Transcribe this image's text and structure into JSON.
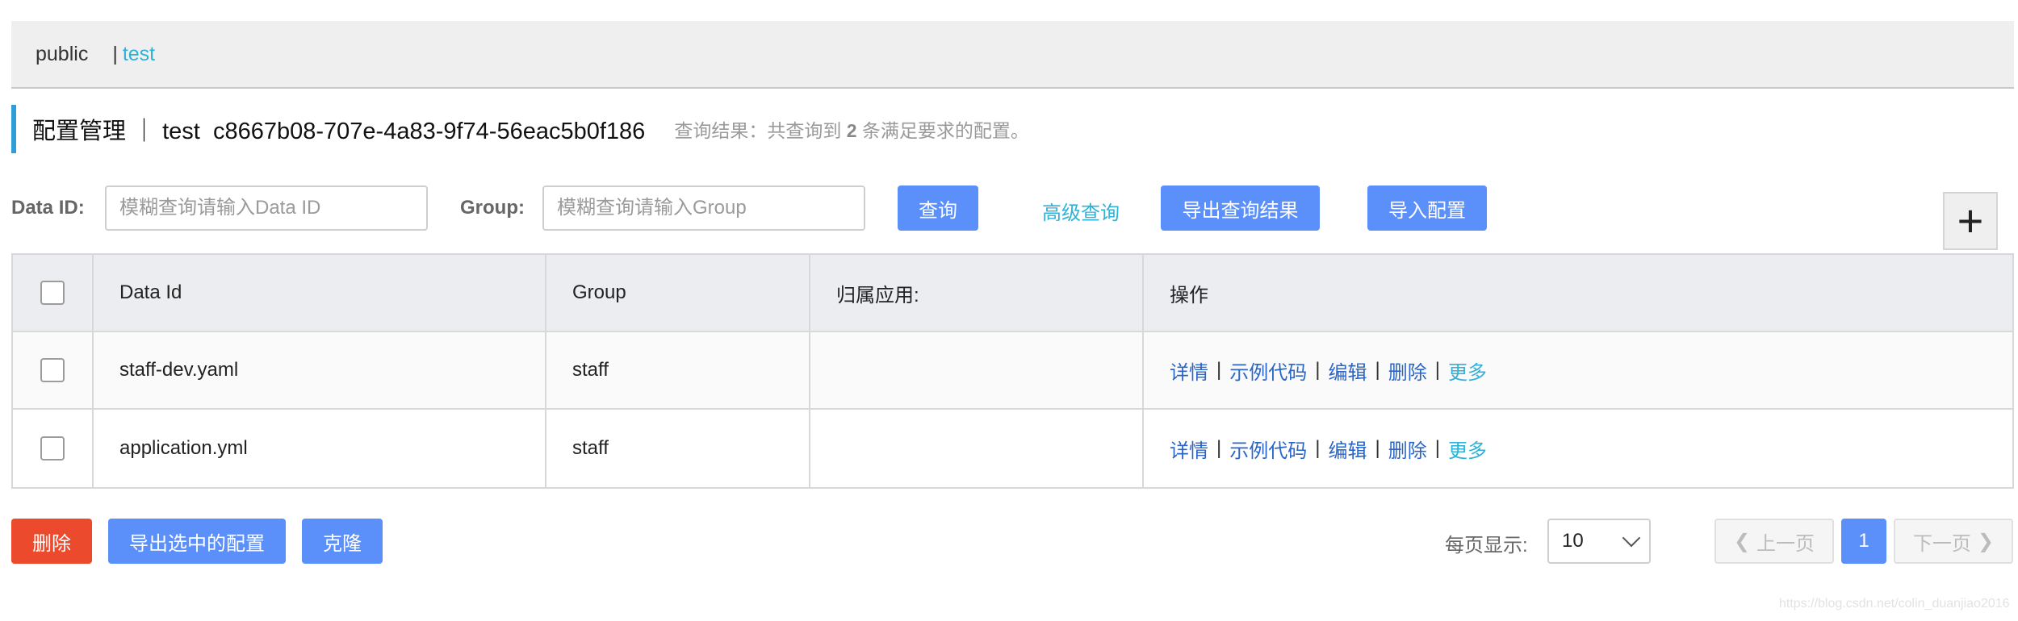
{
  "namespaces": [
    {
      "label": "public"
    },
    {
      "label": "test"
    }
  ],
  "namespace_separator": "|",
  "header": {
    "title": "配置管理 ｜ test  c8667b08-707e-4a83-9f74-56eac5b0f186",
    "result_prefix": "查询结果：共查询到 ",
    "result_count": "2",
    "result_suffix": " 条满足要求的配置。"
  },
  "search": {
    "data_id_label": "Data ID:",
    "data_id_placeholder": "模糊查询请输入Data ID",
    "group_label": "Group:",
    "group_placeholder": "模糊查询请输入Group",
    "query_button": "查询",
    "advanced_query": "高级查询",
    "export_results_button": "导出查询结果",
    "import_config_button": "导入配置",
    "add_button": "+"
  },
  "table": {
    "columns": [
      "Data Id",
      "Group",
      "归属应用:",
      "操作"
    ],
    "rows": [
      {
        "data_id": "staff-dev.yaml",
        "group": "staff",
        "app": ""
      },
      {
        "data_id": "application.yml",
        "group": "staff",
        "app": ""
      }
    ],
    "actions": {
      "detail": "详情",
      "sample_code": "示例代码",
      "edit": "编辑",
      "delete": "删除",
      "more": "更多",
      "separator": "|"
    }
  },
  "footer": {
    "delete_button": "删除",
    "export_selected_button": "导出选中的配置",
    "clone_button": "克隆",
    "page_size_label": "每页显示:",
    "page_size_value": "10",
    "prev_page": "上一页",
    "current_page": "1",
    "next_page": "下一页"
  },
  "watermark": "https://blog.csdn.net/colin_duanjiao2016",
  "colors": {
    "primary": "#5b8ff9",
    "danger": "#ec4a2c",
    "link": "#2a66c8",
    "accent_link": "#2fb2d6"
  }
}
